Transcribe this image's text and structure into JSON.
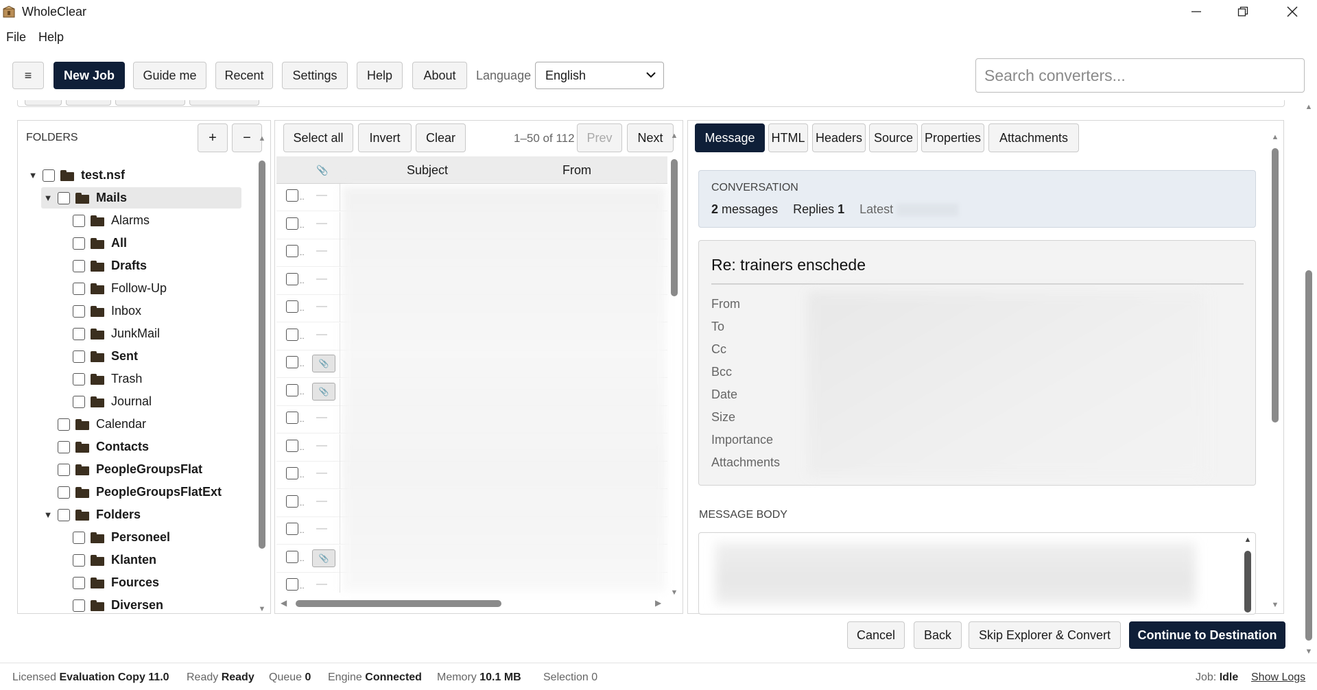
{
  "app": {
    "title": "WholeClear"
  },
  "menu": [
    "File",
    "Help"
  ],
  "toolbar": {
    "menu_icon": "≡",
    "new_job": "New Job",
    "guide_me": "Guide me",
    "recent": "Recent",
    "settings": "Settings",
    "help": "Help",
    "about": "About",
    "language_label": "Language",
    "language_value": "English",
    "search_placeholder": "Search converters..."
  },
  "folders": {
    "heading": "FOLDERS",
    "add": "+",
    "remove": "−",
    "tree": [
      {
        "label": "test.nsf",
        "bold": true,
        "level": 0,
        "expanded": true
      },
      {
        "label": "Mails",
        "bold": true,
        "level": 1,
        "expanded": true,
        "selected": true
      },
      {
        "label": "Alarms",
        "bold": false,
        "level": 2
      },
      {
        "label": "All",
        "bold": true,
        "level": 2
      },
      {
        "label": "Drafts",
        "bold": true,
        "level": 2
      },
      {
        "label": "Follow-Up",
        "bold": false,
        "level": 2
      },
      {
        "label": "Inbox",
        "bold": false,
        "level": 2
      },
      {
        "label": "JunkMail",
        "bold": false,
        "level": 2
      },
      {
        "label": "Sent",
        "bold": true,
        "level": 2
      },
      {
        "label": "Trash",
        "bold": false,
        "level": 2
      },
      {
        "label": "Journal",
        "bold": false,
        "level": 2
      },
      {
        "label": "Calendar",
        "bold": false,
        "level": 1
      },
      {
        "label": "Contacts",
        "bold": true,
        "level": 1
      },
      {
        "label": "PeopleGroupsFlat",
        "bold": true,
        "level": 1
      },
      {
        "label": "PeopleGroupsFlatExt",
        "bold": true,
        "level": 1
      },
      {
        "label": "Folders",
        "bold": true,
        "level": 1,
        "expanded": true
      },
      {
        "label": "Personeel",
        "bold": true,
        "level": 2
      },
      {
        "label": "Klanten",
        "bold": true,
        "level": 2
      },
      {
        "label": "Fources",
        "bold": true,
        "level": 2
      },
      {
        "label": "Diversen",
        "bold": true,
        "level": 2
      }
    ]
  },
  "list": {
    "select_all": "Select all",
    "invert": "Invert",
    "clear": "Clear",
    "range": "1–50 of 112",
    "prev": "Prev",
    "next": "Next",
    "col_attach": "📎",
    "col_subject": "Subject",
    "col_from": "From",
    "rows": [
      {
        "attach": false
      },
      {
        "attach": false
      },
      {
        "attach": false
      },
      {
        "attach": false
      },
      {
        "attach": false
      },
      {
        "attach": false
      },
      {
        "attach": true
      },
      {
        "attach": true
      },
      {
        "attach": false
      },
      {
        "attach": false
      },
      {
        "attach": false
      },
      {
        "attach": false
      },
      {
        "attach": false
      },
      {
        "attach": true
      },
      {
        "attach": false
      }
    ],
    "row_marker": "..",
    "row_dash": "—",
    "row_clip": "📎"
  },
  "preview": {
    "tabs": [
      "Message",
      "HTML",
      "Headers",
      "Source",
      "Properties",
      "Attachments"
    ],
    "active_tab": "Message",
    "conversation_title": "CONVERSATION",
    "messages_count": "2",
    "messages_label": "messages",
    "replies_label": "Replies",
    "replies_count": "1",
    "latest_label": "Latest",
    "subject": "Re: trainers enschede",
    "fields": [
      "From",
      "To",
      "Cc",
      "Bcc",
      "Date",
      "Size",
      "Importance",
      "Attachments"
    ],
    "body_title": "MESSAGE BODY"
  },
  "actions": {
    "cancel": "Cancel",
    "back": "Back",
    "skip": "Skip Explorer & Convert",
    "continue": "Continue to Destination"
  },
  "status": {
    "licensed_label": "Licensed",
    "licensed_value": "Evaluation Copy 11.0",
    "ready_label": "Ready",
    "ready_value": "Ready",
    "queue_label": "Queue",
    "queue_value": "0",
    "engine_label": "Engine",
    "engine_value": "Connected",
    "memory_label": "Memory",
    "memory_value": "10.1 MB",
    "selection_label": "Selection",
    "selection_value": "0",
    "job_label": "Job:",
    "job_value": "Idle",
    "show_logs": "Show Logs"
  },
  "colors": {
    "primary": "#0f1f38",
    "conversation_bg": "#e8edf3",
    "folder_icon": "#3b2f1f"
  }
}
